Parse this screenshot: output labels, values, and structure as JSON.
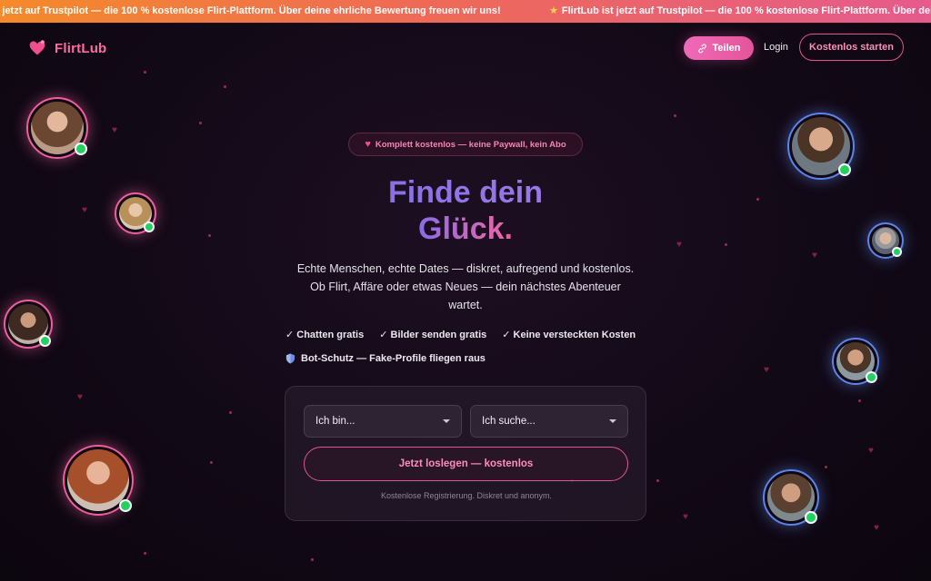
{
  "banner": {
    "text_a": "ub ist jetzt auf Trustpilot — die 100 % kostenlose Flirt-Plattform. Über deine ehrliche Bewertung freuen wir uns!",
    "text_b": "FlirtLub ist jetzt auf Trustpilot — die 100 % kostenlose Flirt-Plattform. Über deine e",
    "star_icon": "star-icon"
  },
  "header": {
    "logo_text": "FlirtLub",
    "share_label": "Teilen",
    "login_label": "Login",
    "start_label": "Kostenlos starten"
  },
  "hero": {
    "pill_text": "Komplett kostenlos — keine Paywall, kein Abo",
    "title_line1": "Finde dein",
    "title_line2": "Glück",
    "title_dot": ".",
    "subtitle_1": "Echte Menschen, echte Dates — diskret, aufregend und kostenlos.",
    "subtitle_2": "Ob Flirt, Affäre oder etwas Neues — dein nächstes Abenteuer",
    "subtitle_3": "wartet.",
    "features": [
      "✓ Chatten gratis",
      "✓ Bilder senden gratis",
      "✓ Keine versteckten Kosten"
    ],
    "bot_text": "Bot-Schutz — Fake-Profile fliegen raus"
  },
  "form": {
    "i_am_value": "Ich bin...",
    "looking_for_value": "Ich suche...",
    "cta_label": "Jetzt loslegen — kostenlos",
    "note": "Kostenlose Registrierung. Diskret und anonym."
  },
  "colors": {
    "accent_pink": "#ef5f9e",
    "accent_blue": "#5b85ea",
    "online_green": "#22d160",
    "background": "#120916"
  }
}
